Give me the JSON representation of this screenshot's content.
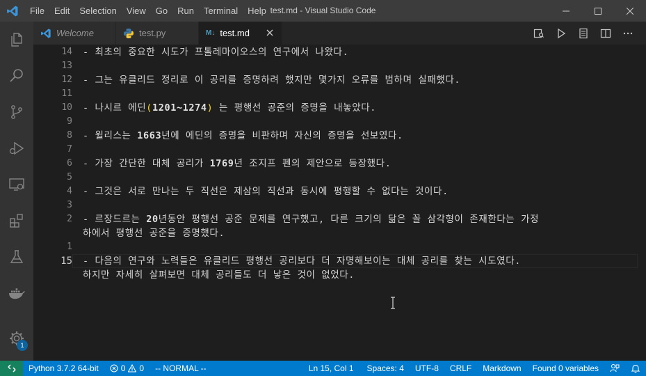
{
  "window": {
    "title": "test.md - Visual Studio Code"
  },
  "menu": [
    "File",
    "Edit",
    "Selection",
    "View",
    "Go",
    "Run",
    "Terminal",
    "Help"
  ],
  "tabs": [
    {
      "label": "Welcome",
      "icon": "vscode-icon"
    },
    {
      "label": "test.py",
      "icon": "python-icon"
    },
    {
      "label": "test.md",
      "icon": "markdown-icon",
      "active": true
    }
  ],
  "markdown_icon_text": "M↓",
  "activity_bar": {
    "items": [
      "explorer-icon",
      "search-icon",
      "source-control-icon",
      "run-debug-icon",
      "remote-explorer-icon",
      "extensions-icon",
      "testing-icon",
      "docker-icon"
    ],
    "manage_badge": "1"
  },
  "editor": {
    "line_numbers": [
      "14",
      "13",
      "12",
      "11",
      "10",
      "9",
      "8",
      "7",
      "6",
      "5",
      "4",
      "3",
      "2",
      "",
      "1",
      "15",
      ""
    ],
    "lines": {
      "l14": "- 최초의 중요한 시도가 프톨레마이오스의 연구에서 나왔다.",
      "l12": "- 그는 유클리드 정리로 이 공리를 증명하려 했지만 몇가지 오류를 범하며 실패했다.",
      "l10_a": "- 나시르 에딘",
      "l10_b": "(",
      "l10_c": "1201~1274",
      "l10_d": ")",
      "l10_e": " 는 평행선 공준의 증명을 내놓았다.",
      "l8_a": "- 윌리스는 ",
      "l8_b": "1663",
      "l8_c": "년에 에딘의 증명을 비판하며 자신의 증명을 선보였다.",
      "l6_a": "- 가장 간단한 대체 공리가 ",
      "l6_b": "1769",
      "l6_c": "년 조지프 펜의 제안으로 등장했다.",
      "l4": "- 그것은 서로 만나는 두 직선은 제삼의 직선과 동시에 평행할 수 없다는 것이다.",
      "l2_a": "- 르장드르는 ",
      "l2_b": "20",
      "l2_c": "년동안 평행선 공준 문제를 연구했고, 다른 크기의 닮은 꼴 삼각형이 존재한다는 가정",
      "l2_wrap": "하에서 평행선 공준을 증명했다.",
      "l15": "- 다음의 연구와 노력들은 유클리드 평행선 공리보다 더 자명해보이는 대체 공리를 찾는 시도였다.",
      "l15_wrap": "하지만 자세히 살펴보면 대체 공리들도 더 낳은 것이 없었다."
    }
  },
  "status_bar": {
    "python": "Python 3.7.2 64-bit",
    "errors": "0",
    "warnings": "0",
    "vim_mode": "-- NORMAL --",
    "position": "Ln 15, Col 1",
    "spaces": "Spaces: 4",
    "encoding": "UTF-8",
    "eol": "CRLF",
    "language": "Markdown",
    "variables": "Found 0 variables"
  },
  "colors": {
    "statusbar": "#007acc",
    "remote": "#16825d",
    "accent": "#0e639c"
  }
}
